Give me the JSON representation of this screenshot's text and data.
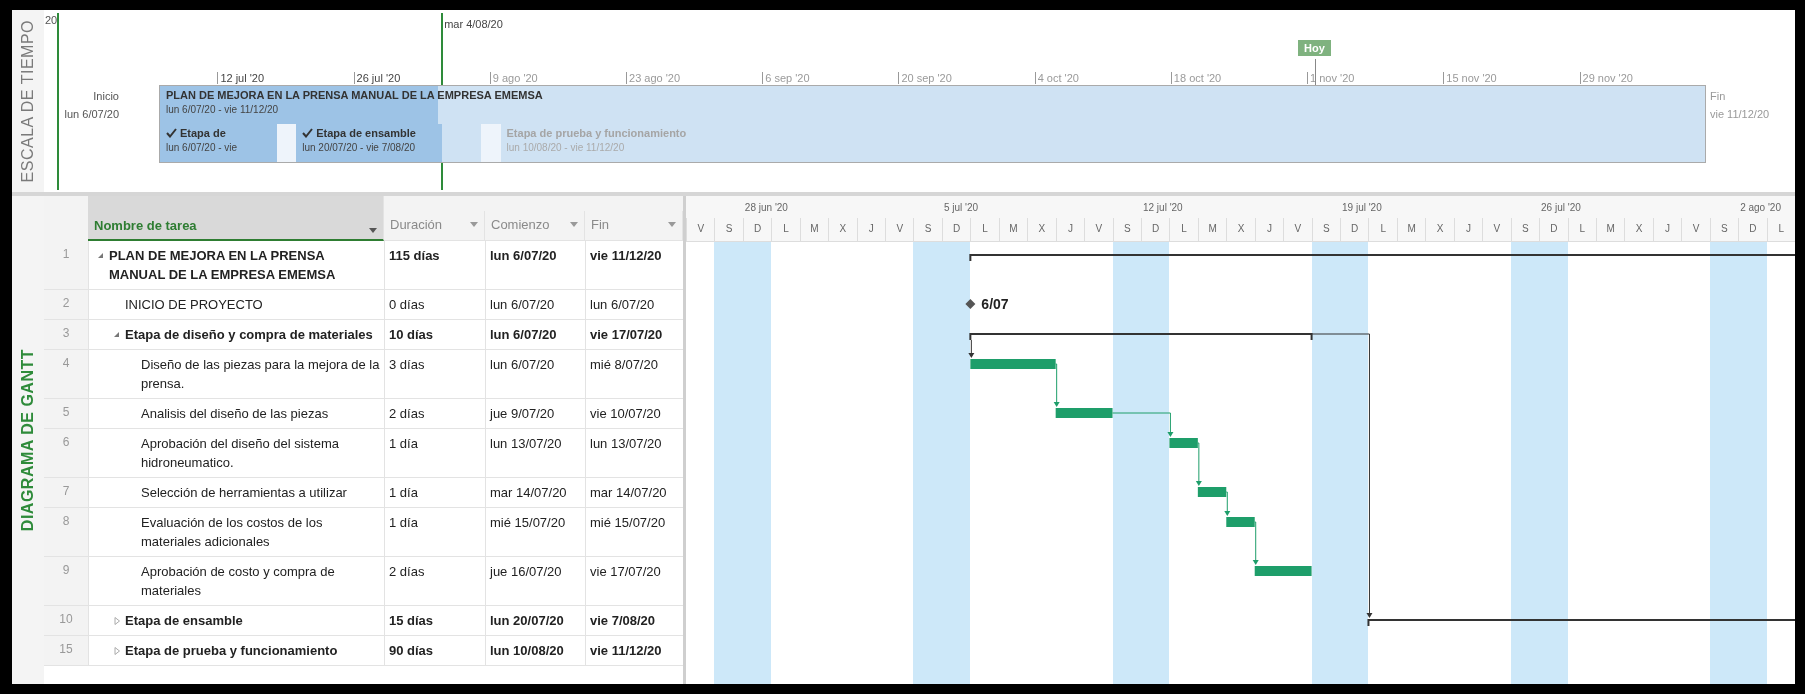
{
  "timeline": {
    "title": "ESCALA DE TIEMPO",
    "edge_label": "20",
    "status_date": "mar 4/08/20",
    "today": {
      "label": "Hoy",
      "level": 0.747
    },
    "start": {
      "label": "Inicio",
      "date": "lun 6/07/20"
    },
    "finish": {
      "label": "Fin",
      "date": "vie 11/12/20"
    },
    "ticks": [
      {
        "label": "12 jul '20",
        "past": true
      },
      {
        "label": "26 jul '20",
        "past": true
      },
      {
        "label": "9 ago '20",
        "past": false
      },
      {
        "label": "23 ago '20",
        "past": false
      },
      {
        "label": "6 sep '20",
        "past": false
      },
      {
        "label": "20 sep '20",
        "past": false
      },
      {
        "label": "4 oct '20",
        "past": false
      },
      {
        "label": "18 oct '20",
        "past": false
      },
      {
        "label": "1 nov '20",
        "past": false
      },
      {
        "label": "15 nov '20",
        "past": false
      },
      {
        "label": "29 nov '20",
        "past": false
      }
    ],
    "project": {
      "name": "PLAN DE MEJORA EN LA PRENSA MANUAL DE LA EMPRESA EMEMSA",
      "dates": "lun 6/07/20 - vie 11/12/20",
      "level": 0.18
    },
    "stages": [
      {
        "name": "Etapa de",
        "dates": "lun 6/07/20 - vie",
        "done": true,
        "level": 1
      },
      {
        "name": "Etapa de ensamble",
        "dates": "lun 20/07/20 - vie 7/08/20",
        "done": true,
        "level": 0.79
      },
      {
        "name": "Etapa de prueba y funcionamiento",
        "dates": "lun 10/08/20 - vie 11/12/20",
        "done": false,
        "level": 0
      }
    ]
  },
  "gantt": {
    "title": "DIAGRAMA DE GANTT",
    "columns": [
      {
        "label": "Nombre de tarea",
        "selected": true
      },
      {
        "label": "Duración",
        "selected": false
      },
      {
        "label": "Comienzo",
        "selected": false
      },
      {
        "label": "Fin",
        "selected": false
      }
    ],
    "days": [
      {
        "letter": "V",
        "weekend": false
      },
      {
        "letter": "S",
        "weekend": true
      },
      {
        "letter": "D",
        "weekend": true,
        "week": "28 jun '20"
      },
      {
        "letter": "L",
        "weekend": false
      },
      {
        "letter": "M",
        "weekend": false
      },
      {
        "letter": "X",
        "weekend": false
      },
      {
        "letter": "J",
        "weekend": false
      },
      {
        "letter": "V",
        "weekend": false
      },
      {
        "letter": "S",
        "weekend": true
      },
      {
        "letter": "D",
        "weekend": true,
        "week": "5 jul '20"
      },
      {
        "letter": "L",
        "weekend": false
      },
      {
        "letter": "M",
        "weekend": false
      },
      {
        "letter": "X",
        "weekend": false
      },
      {
        "letter": "J",
        "weekend": false
      },
      {
        "letter": "V",
        "weekend": false
      },
      {
        "letter": "S",
        "weekend": true
      },
      {
        "letter": "D",
        "weekend": true,
        "week": "12 jul '20"
      },
      {
        "letter": "L",
        "weekend": false
      },
      {
        "letter": "M",
        "weekend": false
      },
      {
        "letter": "X",
        "weekend": false
      },
      {
        "letter": "J",
        "weekend": false
      },
      {
        "letter": "V",
        "weekend": false
      },
      {
        "letter": "S",
        "weekend": true
      },
      {
        "letter": "D",
        "weekend": true,
        "week": "19 jul '20"
      },
      {
        "letter": "L",
        "weekend": false
      },
      {
        "letter": "M",
        "weekend": false
      },
      {
        "letter": "X",
        "weekend": false
      },
      {
        "letter": "J",
        "weekend": false
      },
      {
        "letter": "V",
        "weekend": false
      },
      {
        "letter": "S",
        "weekend": true
      },
      {
        "letter": "D",
        "weekend": true,
        "week": "26 jul '20"
      },
      {
        "letter": "L",
        "weekend": false
      },
      {
        "letter": "M",
        "weekend": false
      },
      {
        "letter": "X",
        "weekend": false
      },
      {
        "letter": "J",
        "weekend": false
      },
      {
        "letter": "V",
        "weekend": false
      },
      {
        "letter": "S",
        "weekend": true
      },
      {
        "letter": "D",
        "weekend": true,
        "week": "2 ago '20"
      },
      {
        "letter": "L",
        "weekend": false
      }
    ],
    "tasks": [
      {
        "id": "1",
        "name": "PLAN DE MEJORA EN LA PRENSA MANUAL DE LA EMPRESA EMEMSA",
        "duration": "115 días",
        "start": "lun 6/07/20",
        "finish": "vie 11/12/20",
        "kind": "summary",
        "expanded": true,
        "children": [
          {
            "id": "2",
            "name": "INICIO DE PROYECTO",
            "duration": "0 días",
            "start": "lun 6/07/20",
            "finish": "lun 6/07/20",
            "kind": "milestone",
            "bar_label": "6/07"
          },
          {
            "id": "3",
            "name": "Etapa de diseño y compra de materiales",
            "duration": "10 días",
            "start": "lun 6/07/20",
            "finish": "vie 17/07/20",
            "kind": "summary",
            "expanded": true,
            "children": [
              {
                "id": "4",
                "name": "Diseño de las piezas para la mejora de la prensa.",
                "duration": "3 días",
                "start": "lun 6/07/20",
                "finish": "mié 8/07/20",
                "kind": "task"
              },
              {
                "id": "5",
                "name": "Analisis del diseño de las piezas",
                "duration": "2 días",
                "start": "jue 9/07/20",
                "finish": "vie 10/07/20",
                "kind": "task"
              },
              {
                "id": "6",
                "name": "Aprobación del diseño del sistema hidroneumatico.",
                "duration": "1 día",
                "start": "lun 13/07/20",
                "finish": "lun 13/07/20",
                "kind": "task"
              },
              {
                "id": "7",
                "name": "Selección de herramientas a utilizar",
                "duration": "1 día",
                "start": "mar 14/07/20",
                "finish": "mar 14/07/20",
                "kind": "task"
              },
              {
                "id": "8",
                "name": "Evaluación de los costos de los materiales adicionales",
                "duration": "1 día",
                "start": "mié 15/07/20",
                "finish": "mié 15/07/20",
                "kind": "task"
              },
              {
                "id": "9",
                "name": "Aprobación de costo y compra de materiales",
                "duration": "2 días",
                "start": "jue 16/07/20",
                "finish": "vie 17/07/20",
                "kind": "task"
              }
            ]
          },
          {
            "id": "10",
            "name": "Etapa de ensamble",
            "duration": "15 días",
            "start": "lun 20/07/20",
            "finish": "vie 7/08/20",
            "kind": "summary",
            "expanded": false
          },
          {
            "id": "15",
            "name": "Etapa de prueba y funcionamiento",
            "duration": "90 días",
            "start": "lun 10/08/20",
            "finish": "vie 11/12/20",
            "kind": "summary",
            "expanded": false
          }
        ]
      }
    ]
  }
}
